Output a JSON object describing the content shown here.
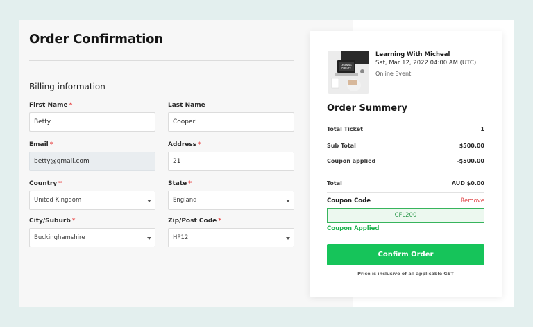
{
  "page": {
    "title": "Order Confirmation"
  },
  "billing": {
    "title": "Billing information",
    "first_name": {
      "label": "First Name",
      "required": "*",
      "value": "Betty"
    },
    "last_name": {
      "label": "Last Name",
      "value": "Cooper"
    },
    "email": {
      "label": "Email",
      "required": "*",
      "value": "betty@gmail.com"
    },
    "address": {
      "label": "Address",
      "required": "*",
      "value": "21"
    },
    "country": {
      "label": "Country",
      "required": "*",
      "value": "United Kingdom"
    },
    "state": {
      "label": "State",
      "required": "*",
      "value": "England"
    },
    "city": {
      "label": "City/Suburb",
      "required": "*",
      "value": "Buckinghamshire"
    },
    "zip": {
      "label": "Zip/Post Code",
      "required": "*",
      "value": "HP12"
    }
  },
  "event": {
    "title": "Learning With Micheal",
    "date": "Sat, Mar 12, 2022 04:00 AM (UTC)",
    "type": "Online Event"
  },
  "summary": {
    "title": "Order Summery",
    "rows": [
      {
        "label": "Total Ticket",
        "value": "1"
      },
      {
        "label": "Sub Total",
        "value": "$500.00"
      },
      {
        "label": "Coupon applied",
        "value": "-$500.00"
      }
    ],
    "total": {
      "label": "Total",
      "value": "AUD $0.00"
    },
    "coupon": {
      "label": "Coupon Code",
      "remove": "Remove",
      "code": "CFL200",
      "status": "Coupon Applied"
    },
    "confirm_label": "Confirm Order",
    "note": "Price is inclusive of all applicable GST"
  },
  "colors": {
    "accent_green": "#16c45a",
    "required_red": "#e84a4a",
    "remove_red": "#e0484a",
    "background": "#e3efee"
  }
}
